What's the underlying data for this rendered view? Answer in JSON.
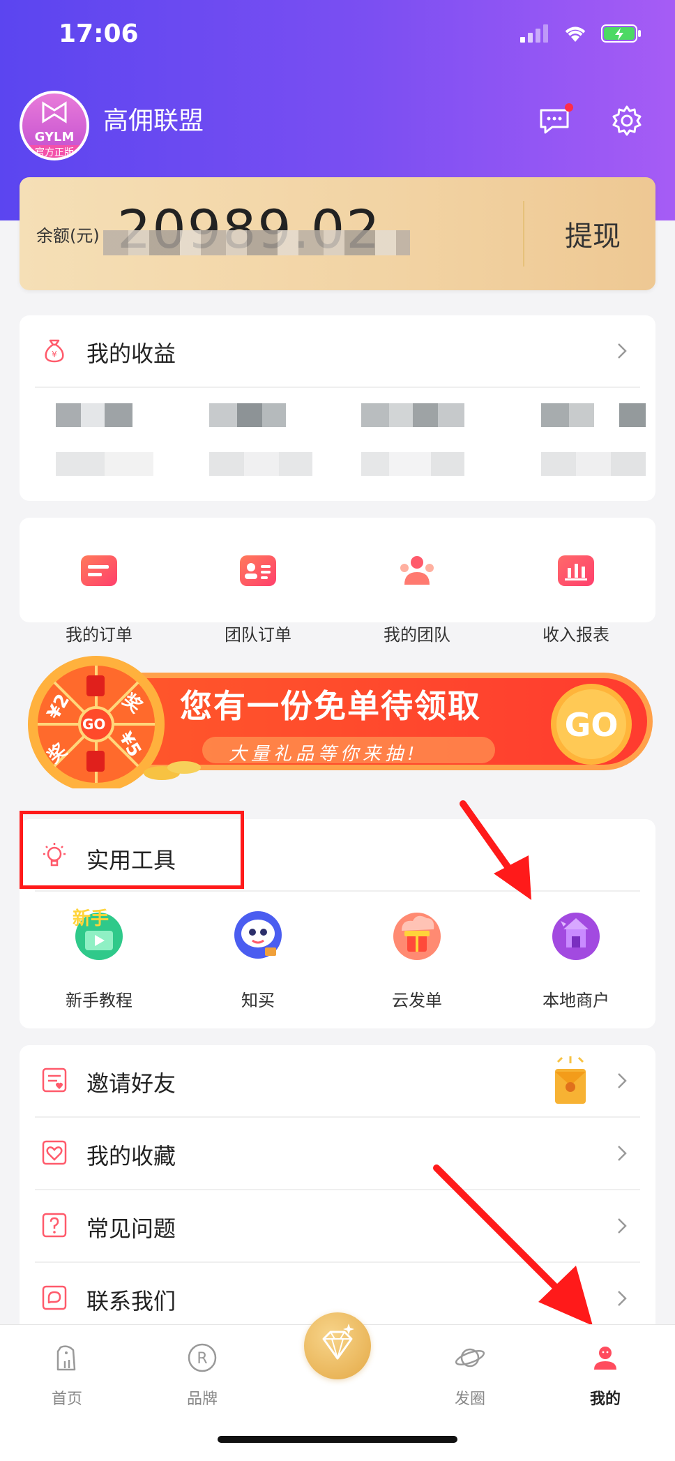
{
  "status_bar": {
    "time": "17:06"
  },
  "profile": {
    "name": "高佣联盟",
    "avatar_text": "GYLM",
    "avatar_subtext": "官方正版"
  },
  "balance": {
    "label": "余额(元)",
    "value": "20989.02",
    "action": "提现"
  },
  "earnings": {
    "title": "我的收益"
  },
  "orders": {
    "items": [
      {
        "label": "我的订单",
        "icon": "order-icon",
        "color": "#ff5a6b"
      },
      {
        "label": "团队订单",
        "icon": "team-order-icon",
        "color": "#ff5a6b"
      },
      {
        "label": "我的团队",
        "icon": "team-icon",
        "color": "#ff7a70"
      },
      {
        "label": "收入报表",
        "icon": "chart-icon",
        "color": "#ff4c6b"
      }
    ]
  },
  "banner": {
    "headline": "您有一份免单待领取",
    "subline": "大量礼品等你来抽!",
    "button": "GO",
    "wheel_center": "GO",
    "wheel_labels": [
      "¥2",
      "奖",
      "¥5",
      "奖"
    ]
  },
  "tools": {
    "title": "实用工具",
    "items": [
      {
        "label": "新手教程",
        "icon": "tutorial-icon",
        "badge": "新手"
      },
      {
        "label": "知买",
        "icon": "robot-icon"
      },
      {
        "label": "云发单",
        "icon": "cloud-gift-icon"
      },
      {
        "label": "本地商户",
        "icon": "local-shop-icon"
      }
    ]
  },
  "menu": {
    "items": [
      {
        "label": "邀请好友",
        "icon": "invite-icon"
      },
      {
        "label": "我的收藏",
        "icon": "favorite-icon"
      },
      {
        "label": "常见问题",
        "icon": "faq-icon"
      },
      {
        "label": "联系我们",
        "icon": "contact-icon"
      }
    ]
  },
  "tabbar": {
    "items": [
      {
        "label": "首页",
        "icon": "home-bag-icon",
        "active": false
      },
      {
        "label": "品牌",
        "icon": "brand-r-icon",
        "active": false
      },
      {
        "label": "",
        "icon": "diamond-icon",
        "active": false
      },
      {
        "label": "发圈",
        "icon": "planet-icon",
        "active": false
      },
      {
        "label": "我的",
        "icon": "profile-icon",
        "active": true
      }
    ]
  },
  "colors": {
    "header_start": "#5b45f0",
    "header_end": "#a65cf5",
    "accent_red": "#ff1a1a",
    "balance_card": "#f2d3a3"
  }
}
